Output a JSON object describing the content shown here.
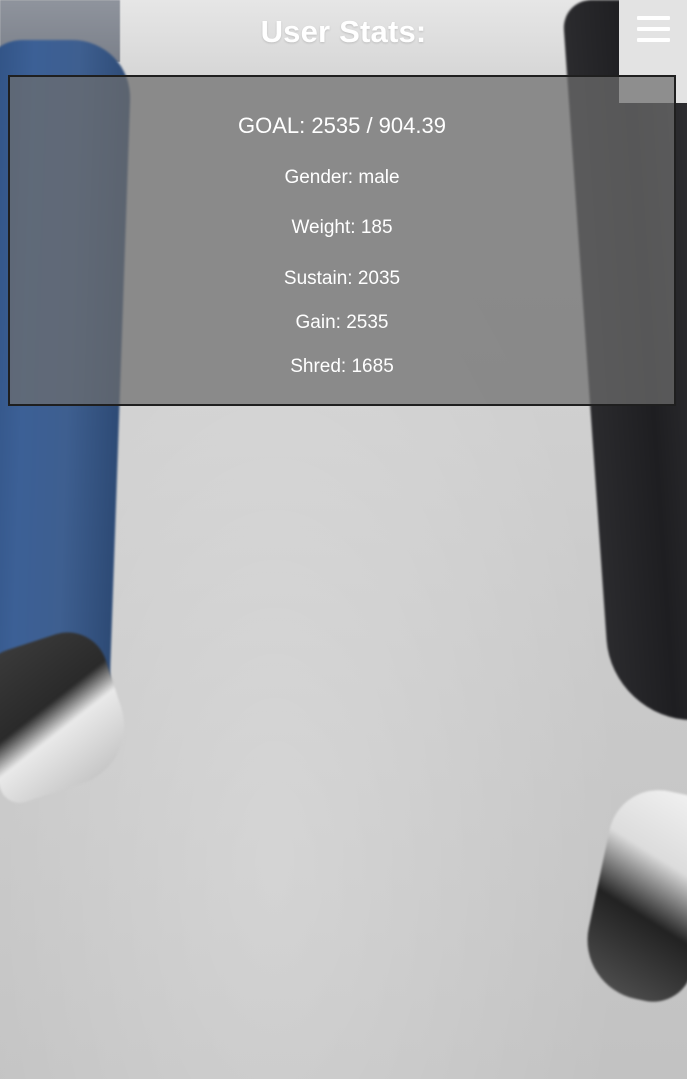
{
  "header": {
    "title": "User Stats:"
  },
  "menu": {
    "icon": "hamburger-menu-icon"
  },
  "stats": {
    "goal": "GOAL: 2535 / 904.39",
    "gender": "Gender: male",
    "weight": "Weight: 185",
    "sustain": "Sustain: 2035",
    "gain": "Gain: 2535",
    "shred": "Shred: 1685"
  },
  "colors": {
    "panel_background": "#6e6e6e",
    "panel_border": "#1f1f1f",
    "text": "#ffffff",
    "menu_background": "#e3e3e3"
  }
}
